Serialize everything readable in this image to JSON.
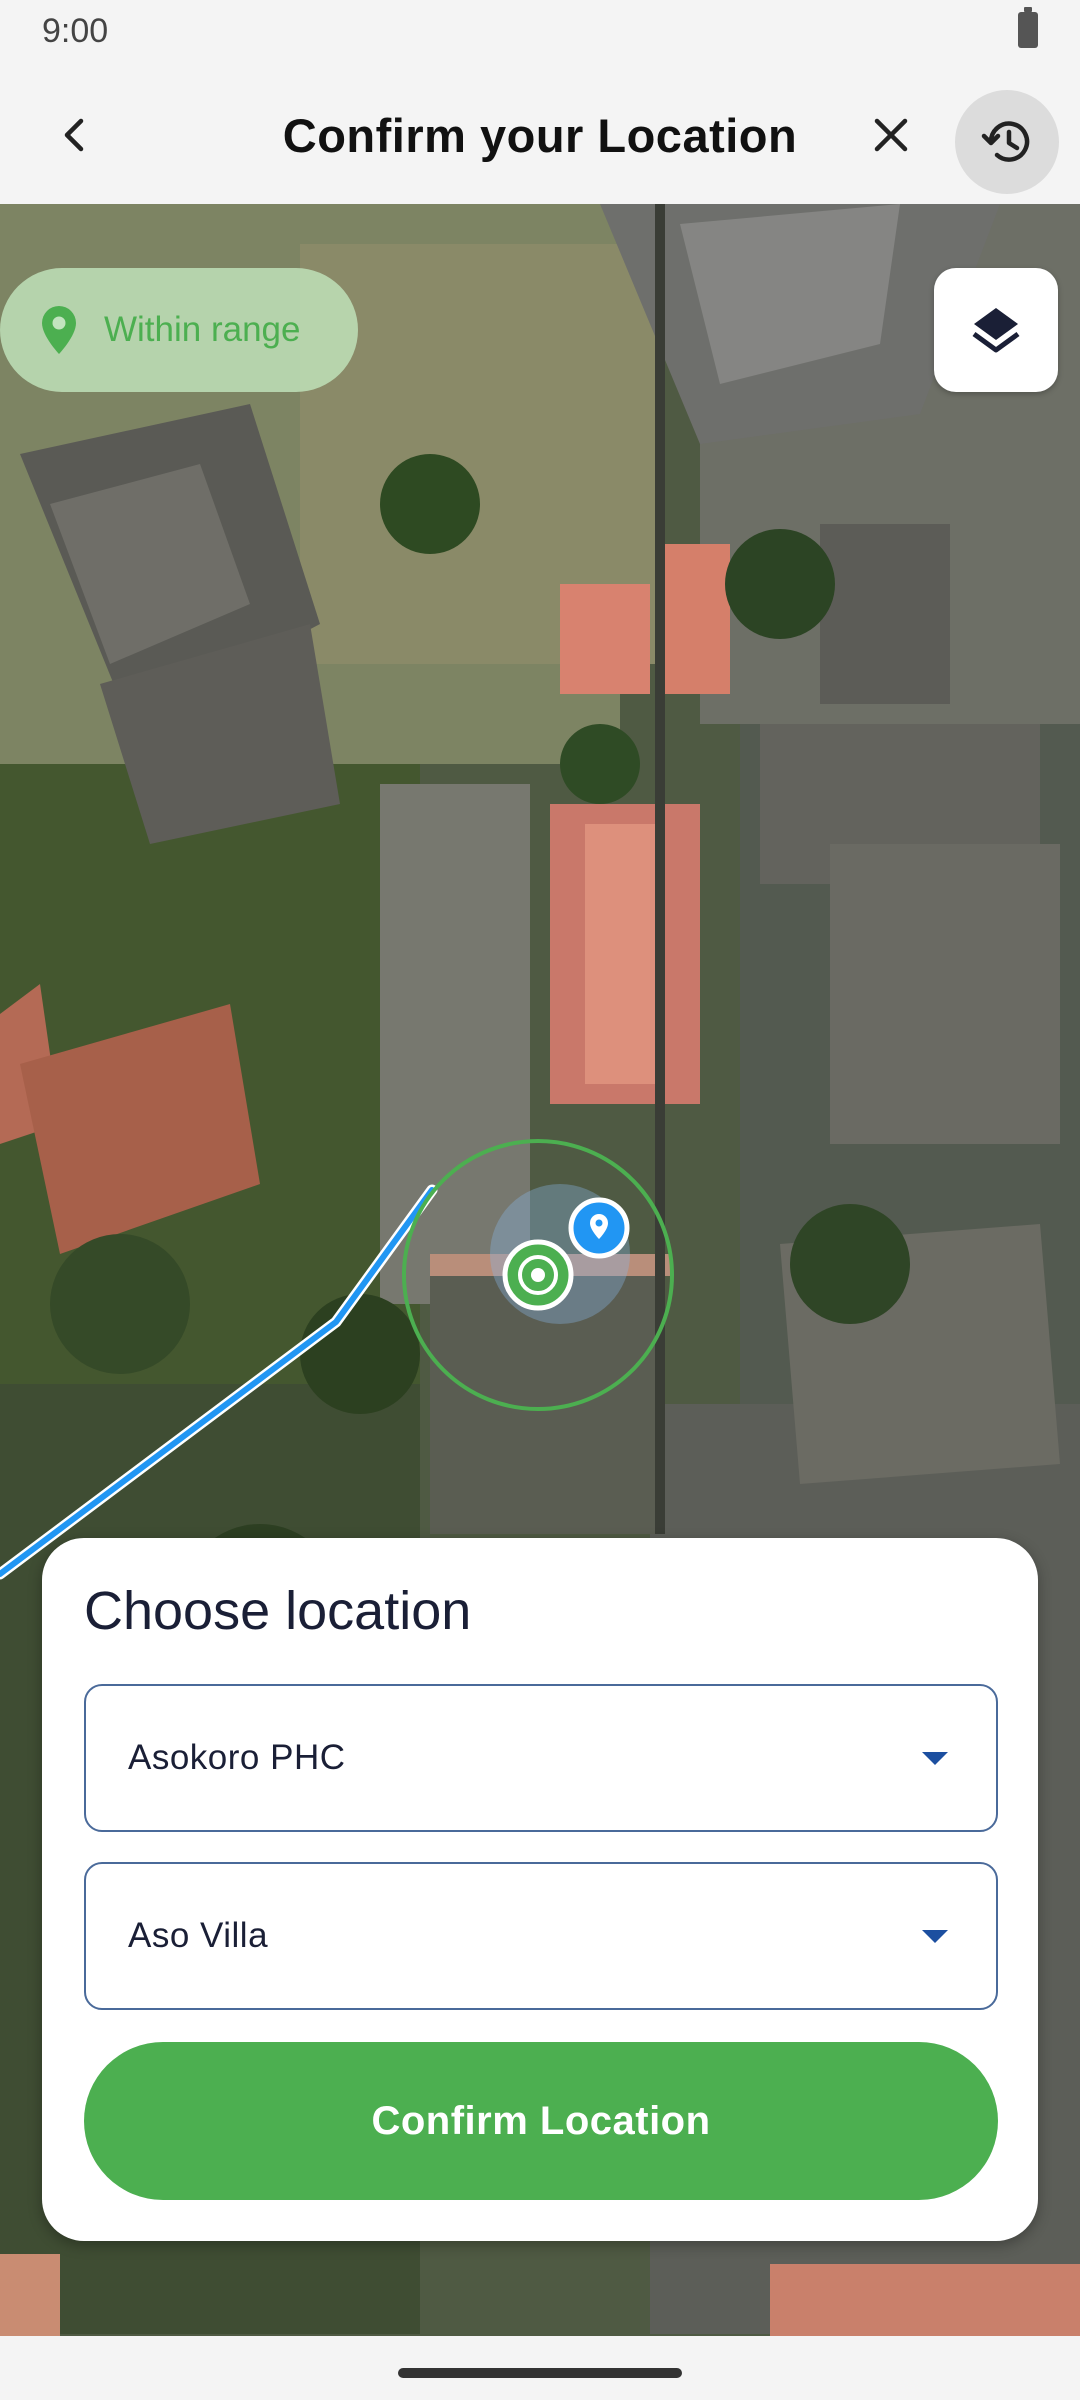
{
  "status_bar": {
    "time": "9:00",
    "icons": [
      "battery-icon"
    ]
  },
  "app_bar": {
    "title": "Confirm your Location",
    "icons": [
      "back-arrow-icon",
      "close-icon",
      "history-icon"
    ]
  },
  "map": {
    "range_chip": {
      "label": "Within range",
      "icon": "location-pin-icon",
      "color": "#4caf50"
    },
    "layers_icon": "layers-icon",
    "route_color": "#2196f3",
    "geofence_color": "#4caf50"
  },
  "location_card": {
    "title": "Choose location",
    "facility_dropdown": {
      "value": "Asokoro PHC"
    },
    "area_dropdown": {
      "value": "Aso Villa"
    },
    "confirm_label": "Confirm Location",
    "accent": "#4caf50"
  }
}
